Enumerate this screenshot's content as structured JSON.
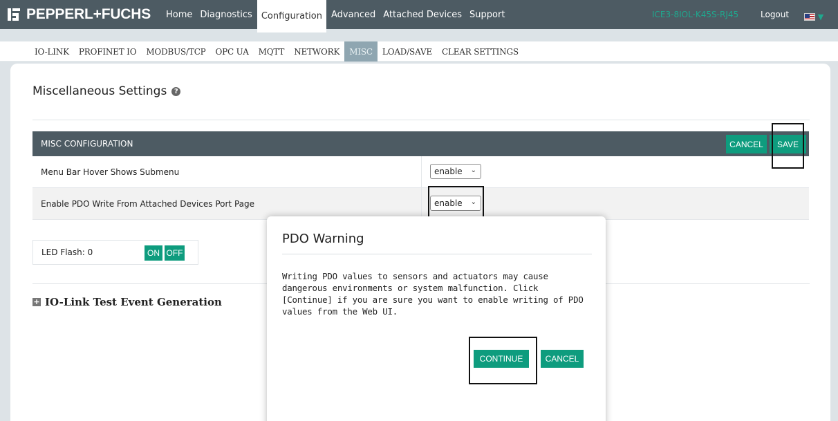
{
  "brand": {
    "name": "PEPPERL+FUCHS",
    "logo_icon": "pf-logo-icon"
  },
  "nav": {
    "items": [
      {
        "label": "Home",
        "active": false
      },
      {
        "label": "Diagnostics",
        "active": false
      },
      {
        "label": "Configuration",
        "active": true
      },
      {
        "label": "Advanced",
        "active": false
      },
      {
        "label": "Attached Devices",
        "active": false
      },
      {
        "label": "Support",
        "active": false
      }
    ],
    "device_name": "ICE3-8IOL-K45S-RJ45",
    "logout": "Logout",
    "language_icon": "us-flag-icon"
  },
  "subnav": {
    "items": [
      {
        "label": "IO-LINK",
        "active": false
      },
      {
        "label": "PROFINET IO",
        "active": false
      },
      {
        "label": "MODBUS/TCP",
        "active": false
      },
      {
        "label": "OPC UA",
        "active": false
      },
      {
        "label": "MQTT",
        "active": false
      },
      {
        "label": "NETWORK",
        "active": false
      },
      {
        "label": "MISC",
        "active": true
      },
      {
        "label": "LOAD/SAVE",
        "active": false
      },
      {
        "label": "CLEAR SETTINGS",
        "active": false
      }
    ]
  },
  "page": {
    "title": "Miscellaneous Settings"
  },
  "misc_config": {
    "header": "MISC CONFIGURATION",
    "cancel": "CANCEL",
    "save": "SAVE",
    "rows": [
      {
        "label": "Menu Bar Hover Shows Submenu",
        "value": "enable"
      },
      {
        "label": "Enable PDO Write From Attached Devices Port Page",
        "value": "enable"
      }
    ]
  },
  "led": {
    "label": "LED Flash: 0",
    "on": "ON",
    "off": "OFF"
  },
  "test_event": {
    "label": "IO-Link Test Event Generation"
  },
  "modal": {
    "title": "PDO Warning",
    "lines": [
      "Writing PDO values to sensors and actuators may cause",
      "dangerous environments or system malfunction. Click",
      "[Continue] if you are sure you want to enable writing of PDO",
      "values from the Web UI."
    ],
    "continue": "CONTINUE",
    "cancel": "CANCEL"
  },
  "colors": {
    "accent": "#0e9c7e",
    "header_bg": "#4d5b63",
    "active_sub": "#8fa6b1"
  }
}
